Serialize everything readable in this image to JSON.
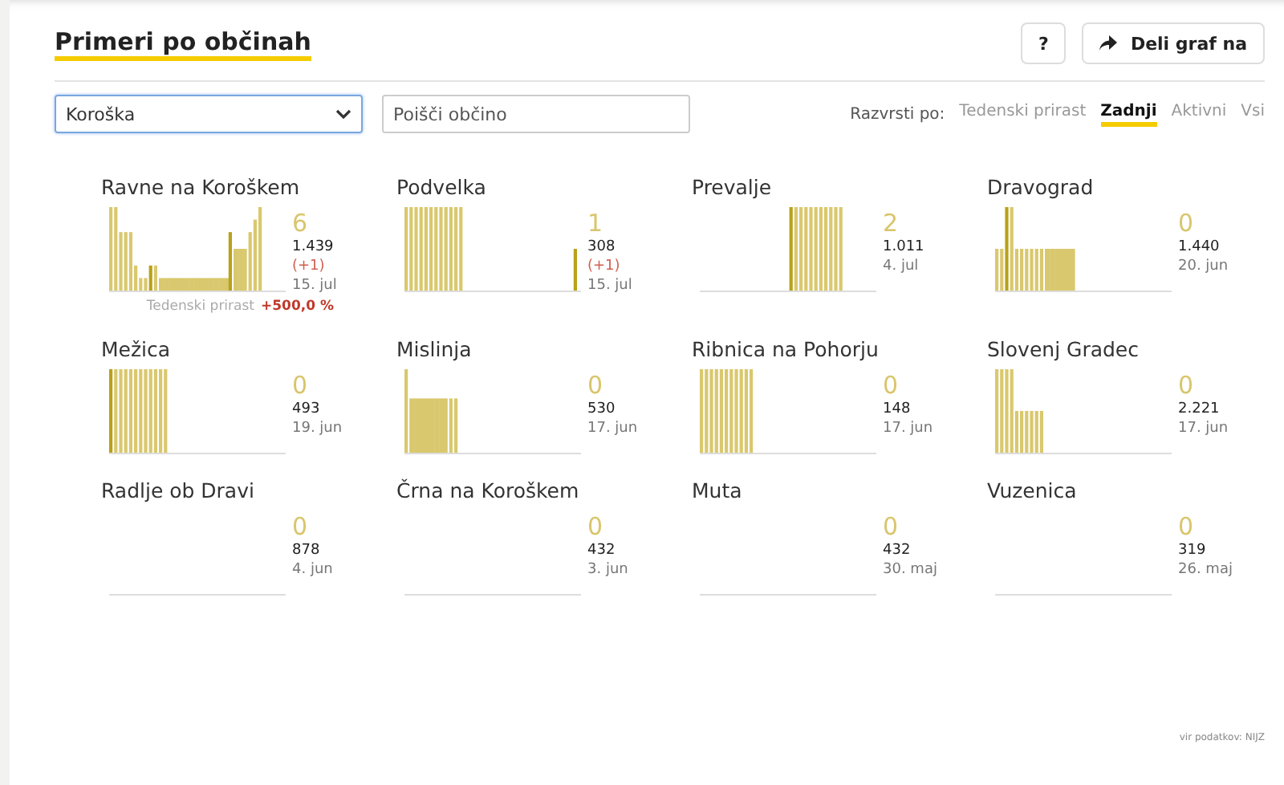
{
  "header": {
    "title": "Primeri po občinah",
    "help_button": "?",
    "share_button": "Deli graf na"
  },
  "filters": {
    "region": "Koroška",
    "search": {
      "placeholder": "Poišči občino"
    },
    "sort_label": "Razvrsti po:",
    "sort_options": [
      {
        "label": "Tedenski prirast",
        "selected": false
      },
      {
        "label": "Zadnji",
        "selected": true
      },
      {
        "label": "Aktivni",
        "selected": false
      },
      {
        "label": "Vsi",
        "selected": false
      }
    ]
  },
  "municipalities": [
    {
      "name": "Ravne na Koroškem",
      "count": "6",
      "total": "1.439",
      "change": "(+1)",
      "date": "15. jul",
      "weekly_growth": {
        "label": "Tedenski prirast",
        "value": "+500,0 %"
      }
    },
    {
      "name": "Podvelka",
      "count": "1",
      "total": "308",
      "change": "(+1)",
      "date": "15. jul"
    },
    {
      "name": "Prevalje",
      "count": "2",
      "total": "1.011",
      "date": "4. jul"
    },
    {
      "name": "Dravograd",
      "count": "0",
      "total": "1.440",
      "date": "20. jun"
    },
    {
      "name": "Mežica",
      "count": "0",
      "total": "493",
      "date": "19. jun"
    },
    {
      "name": "Mislinja",
      "count": "0",
      "total": "530",
      "date": "17. jun"
    },
    {
      "name": "Ribnica na Pohorju",
      "count": "0",
      "total": "148",
      "date": "17. jun"
    },
    {
      "name": "Slovenj Gradec",
      "count": "0",
      "total": "2.221",
      "date": "17. jun"
    },
    {
      "name": "Radlje ob Dravi",
      "count": "0",
      "total": "878",
      "date": "4. jun"
    },
    {
      "name": "Črna na Koroškem",
      "count": "0",
      "total": "432",
      "date": "3. jun"
    },
    {
      "name": "Muta",
      "count": "0",
      "total": "432",
      "date": "30. maj"
    },
    {
      "name": "Vuzenica",
      "count": "0",
      "total": "319",
      "date": "26. maj"
    }
  ],
  "source": "vir podatkov: NIJZ"
}
